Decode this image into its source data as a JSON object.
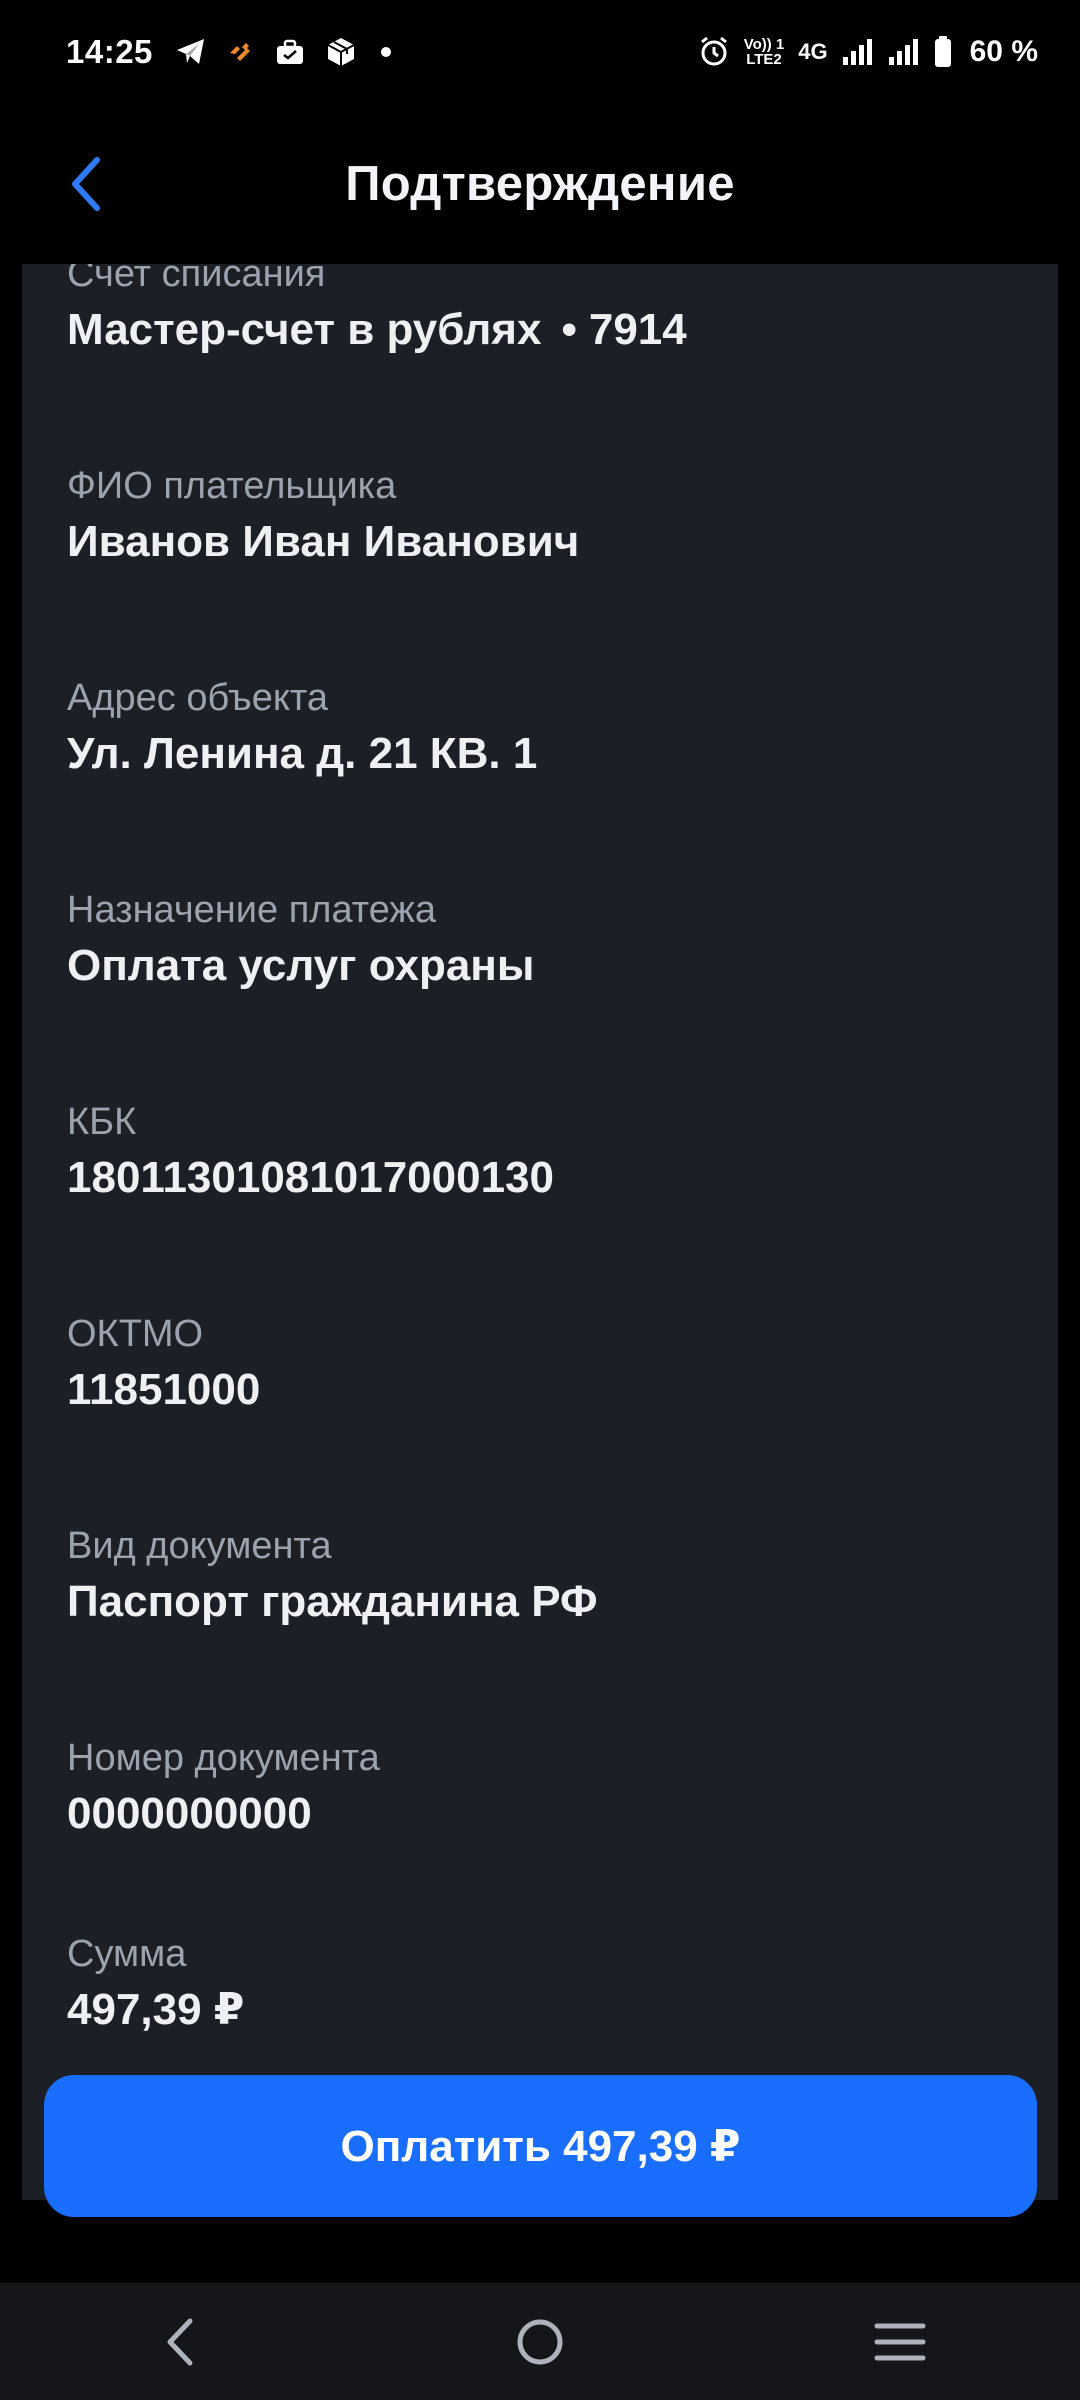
{
  "status_bar": {
    "time": "14:25",
    "volte_top": "Vo)) 1",
    "volte_bottom": "LTE2",
    "network": "4G",
    "battery": "60 %"
  },
  "header": {
    "title": "Подтверждение"
  },
  "fields": [
    {
      "label": "Счет списания",
      "value": "Мастер-счет в рублях",
      "suffix": "7914"
    },
    {
      "label": "ФИО плательщика",
      "value": "Иванов Иван Иванович"
    },
    {
      "label": "Адрес объекта",
      "value": "Ул. Ленина д. 21 КВ. 1"
    },
    {
      "label": "Назначение платежа",
      "value": "Оплата услуг охраны"
    },
    {
      "label": "КБК",
      "value": "18011301081017000130"
    },
    {
      "label": "ОКТМО",
      "value": "11851000"
    },
    {
      "label": "Вид документа",
      "value": "Паспорт гражданина РФ"
    },
    {
      "label": "Номер документа",
      "value": "0000000000"
    },
    {
      "label": "Сумма",
      "value": "497,39 ₽"
    }
  ],
  "pay_button": {
    "label": "Оплатить 497,39 ₽"
  },
  "colors": {
    "background": "#000000",
    "card": "#1C1F26",
    "accent": "#1A6EFF",
    "back_arrow": "#2F7BF5",
    "label": "#9CA3AE",
    "value": "#EEF0F4"
  },
  "icons": {
    "status_left": [
      "telegram-icon",
      "app-notification-icon",
      "briefcase-icon",
      "package-icon"
    ],
    "status_right": [
      "alarm-icon",
      "signal-icon",
      "signal-icon",
      "battery-icon"
    ],
    "nav": [
      "nav-back-icon",
      "nav-home-icon",
      "nav-menu-icon"
    ]
  }
}
